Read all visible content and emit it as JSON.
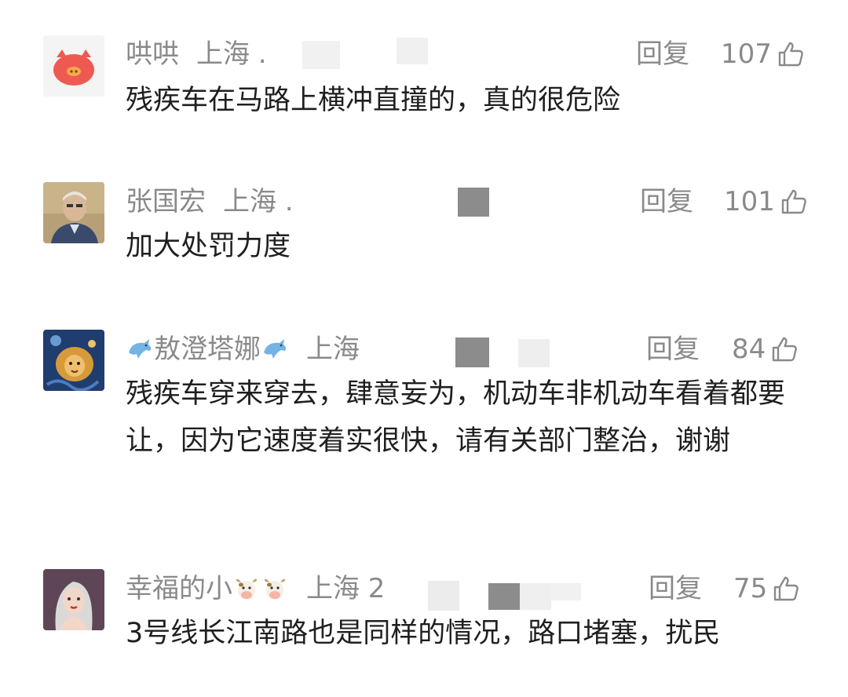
{
  "comments": [
    {
      "username": "哄哄",
      "location": "上海 .",
      "reply_label": "回复",
      "like_count": "107",
      "text": "残疾车在马路上横冲直撞的，真的很危险",
      "avatar_icon": "pink-pig-face-icon"
    },
    {
      "username": "张国宏",
      "location": "上海 .",
      "reply_label": "回复",
      "like_count": "101",
      "text": "加大处罚力度",
      "avatar_icon": "elderly-man-photo"
    },
    {
      "username": "敖澄塔娜",
      "location": "上海",
      "reply_label": "回复",
      "like_count": "84",
      "text": "残疾车穿来穿去，肆意妄为，机动车非机动车看着都要让，因为它速度着实很快，请有关部门整治，谢谢",
      "avatar_icon": "starry-lion-painting",
      "name_emoji": "dolphin-icon"
    },
    {
      "username": "幸福的小",
      "location": "上海 2",
      "reply_label": "回复",
      "like_count": "75",
      "text": "3号线长江南路也是同样的情况，路口堵塞，扰民",
      "avatar_icon": "cartoon-girl-avatar",
      "name_emoji": "cow-face-icon"
    }
  ],
  "colors": {
    "meta_gray": "#8a8a8a",
    "text_dark": "#1f1f1f",
    "redaction": "#8c8c8c"
  }
}
